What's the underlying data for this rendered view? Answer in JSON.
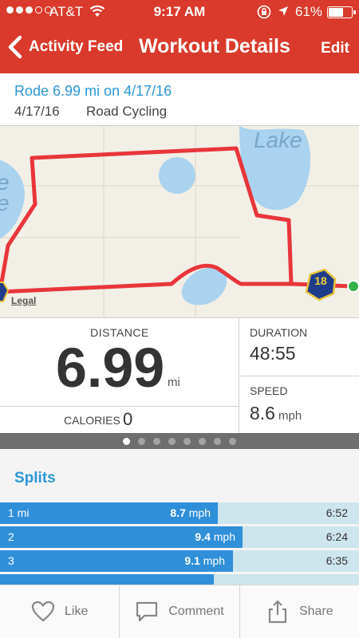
{
  "status_bar": {
    "carrier": "AT&T",
    "time": "9:17 AM",
    "battery": "61%",
    "battery_level": 0.61,
    "signal_bars_filled": 3,
    "signal_bars_total": 5
  },
  "nav": {
    "back_label": "Activity Feed",
    "title": "Workout Details",
    "edit_label": "Edit"
  },
  "workout": {
    "headline": "Rode 6.99 mi on 4/17/16",
    "date": "4/17/16",
    "activity_type": "Road Cycling"
  },
  "map": {
    "lake_label": "Lake",
    "lake_left_label": "e\ne",
    "legal_label": "Legal",
    "route_shield": "18",
    "route_color": "#e8353b",
    "water_color": "#a9d3ef"
  },
  "stats": {
    "distance_label": "DISTANCE",
    "distance_value": "6.99",
    "distance_unit": "mi",
    "calories_label": "CALORIES",
    "calories_value": "0",
    "duration_label": "DURATION",
    "duration_value": "48:55",
    "speed_label": "SPEED",
    "speed_value": "8.6",
    "speed_unit": "mph"
  },
  "pager": {
    "total": 8,
    "active_index": 0
  },
  "splits": {
    "title": "Splits",
    "rows": [
      {
        "label": "1 mi",
        "speed": "8.7",
        "unit": "mph",
        "pace": "6:52"
      },
      {
        "label": "2",
        "speed": "9.4",
        "unit": "mph",
        "pace": "6:24"
      },
      {
        "label": "3",
        "speed": "9.1",
        "unit": "mph",
        "pace": "6:35"
      }
    ]
  },
  "toolbar": {
    "like": "Like",
    "comment": "Comment",
    "share": "Share"
  },
  "colors": {
    "brand": "#d93a2b",
    "accent": "#2b97d6",
    "split_bar": "#2f8fd8"
  }
}
